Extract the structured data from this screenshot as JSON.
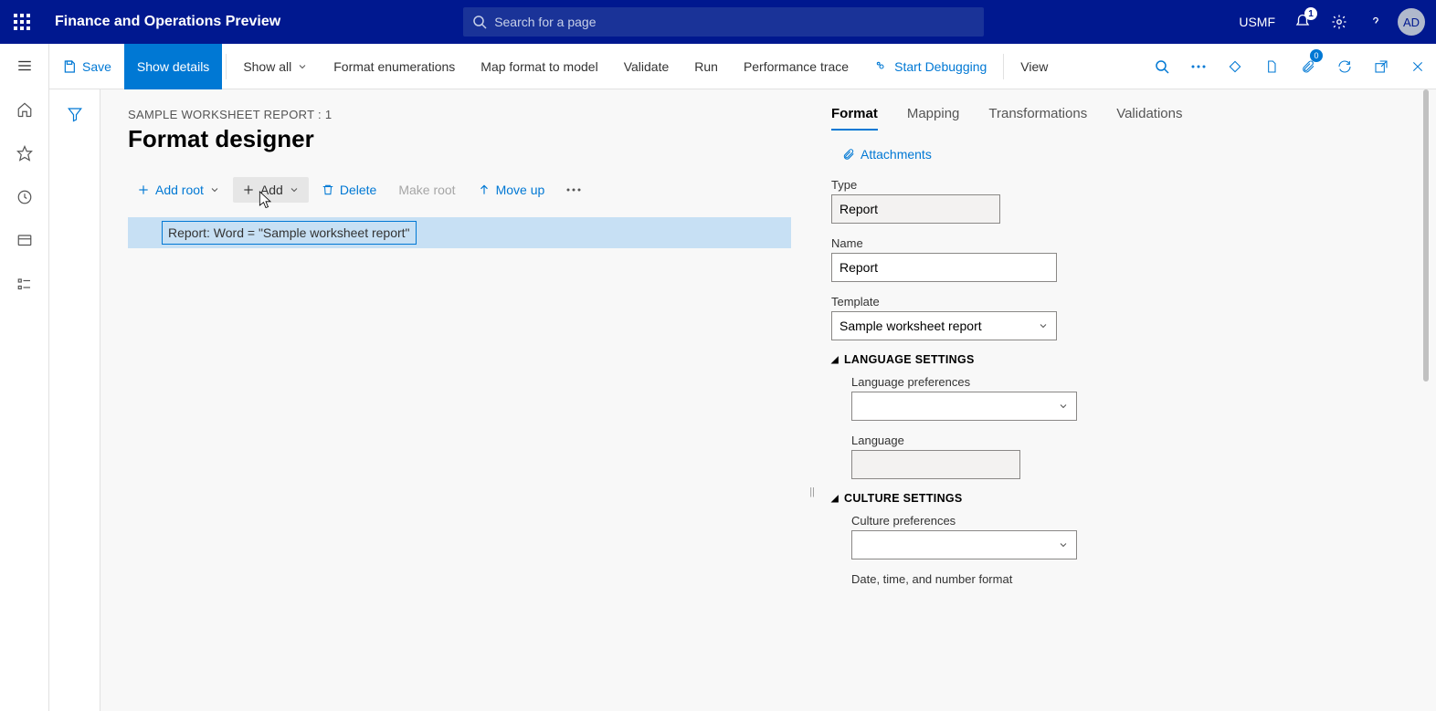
{
  "header": {
    "app_title": "Finance and Operations Preview",
    "search_placeholder": "Search for a page",
    "company": "USMF",
    "notification_count": "1",
    "avatar_initials": "AD"
  },
  "actionbar": {
    "save": "Save",
    "show_details": "Show details",
    "show_all": "Show all",
    "format_enum": "Format enumerations",
    "map_format": "Map format to model",
    "validate": "Validate",
    "run": "Run",
    "perf_trace": "Performance trace",
    "start_debug": "Start Debugging",
    "view": "View",
    "badge_zero": "0"
  },
  "page": {
    "crumb": "SAMPLE WORKSHEET REPORT : 1",
    "title": "Format designer"
  },
  "tree_toolbar": {
    "add_root": "Add root",
    "add": "Add",
    "delete": "Delete",
    "make_root": "Make root",
    "move_up": "Move up"
  },
  "tree": {
    "node_text": "Report: Word = \"Sample worksheet report\""
  },
  "details": {
    "tabs": {
      "format": "Format",
      "mapping": "Mapping",
      "transformations": "Transformations",
      "validations": "Validations"
    },
    "attachments": "Attachments",
    "type_label": "Type",
    "type_value": "Report",
    "name_label": "Name",
    "name_value": "Report",
    "template_label": "Template",
    "template_value": "Sample worksheet report",
    "lang_section": "LANGUAGE SETTINGS",
    "lang_pref_label": "Language preferences",
    "lang_pref_value": "",
    "lang_label": "Language",
    "lang_value": "",
    "culture_section": "CULTURE SETTINGS",
    "culture_pref_label": "Culture preferences",
    "culture_pref_value": "",
    "dtnum_label": "Date, time, and number format"
  }
}
